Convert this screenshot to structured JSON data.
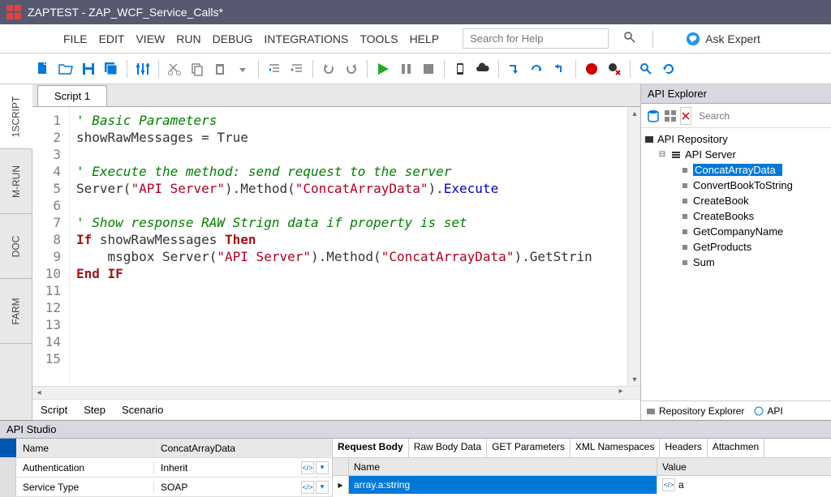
{
  "titlebar": {
    "app": "ZAPTEST",
    "doc": "ZAP_WCF_Service_Calls*"
  },
  "menu": [
    "FILE",
    "EDIT",
    "VIEW",
    "RUN",
    "DEBUG",
    "INTEGRATIONS",
    "TOOLS",
    "HELP"
  ],
  "search_placeholder": "Search for Help",
  "ask_expert": "Ask Expert",
  "left_tabs": [
    "1SCRIPT",
    "M-RUN",
    "DOC",
    "FARM"
  ],
  "script_tab": "Script 1",
  "code": {
    "lines": [
      {
        "n": 1,
        "t": "comment",
        "text": "' Basic Parameters"
      },
      {
        "n": 2,
        "t": "assign",
        "text": "showRawMessages = True"
      },
      {
        "n": 3,
        "t": "blank",
        "text": ""
      },
      {
        "n": 4,
        "t": "comment",
        "text": "' Execute the method: send request to the server"
      },
      {
        "n": 5,
        "t": "call",
        "pre": "Server(",
        "s1": "\"API Server\"",
        "mid1": ").Method(",
        "s2": "\"ConcatArrayData\"",
        "mid2": ").",
        "exec": "Execute"
      },
      {
        "n": 6,
        "t": "blank",
        "text": ""
      },
      {
        "n": 7,
        "t": "comment",
        "text": "' Show response RAW Strign data if property is set"
      },
      {
        "n": 8,
        "t": "ifline",
        "kw": "If",
        "rest": " showRawMessages ",
        "kw2": "Then"
      },
      {
        "n": 9,
        "t": "msgbox",
        "pre": "    msgbox Server(",
        "s1": "\"API Server\"",
        "mid1": ").Method(",
        "s2": "\"ConcatArrayData\"",
        "mid2": ").GetStrin"
      },
      {
        "n": 10,
        "t": "end",
        "text": "End IF"
      },
      {
        "n": 11,
        "t": "blank",
        "text": ""
      },
      {
        "n": 12,
        "t": "blank",
        "text": ""
      },
      {
        "n": 13,
        "t": "blank",
        "text": ""
      },
      {
        "n": 14,
        "t": "blank",
        "text": ""
      },
      {
        "n": 15,
        "t": "blank",
        "text": ""
      }
    ]
  },
  "bottom_tabs": [
    "Script",
    "Step",
    "Scenario"
  ],
  "api_explorer": {
    "title": "API Explorer",
    "search_placeholder": "Search",
    "root": "API Repository",
    "server": "API Server",
    "methods": [
      "ConcatArrayData",
      "ConvertBookToString",
      "CreateBook",
      "CreateBooks",
      "GetCompanyName",
      "GetProducts",
      "Sum"
    ],
    "selected_index": 0,
    "bottom_tabs": [
      "Repository Explorer",
      "API"
    ]
  },
  "api_studio": {
    "title": "API Studio",
    "headers": {
      "name": "Name",
      "value": "ConcatArrayData"
    },
    "rows": [
      {
        "name": "Authentication",
        "value": "Inherit"
      },
      {
        "name": "Service Type",
        "value": "SOAP"
      }
    ],
    "request_tabs": [
      "Request Body",
      "Raw Body Data",
      "GET Parameters",
      "XML Namespaces",
      "Headers",
      "Attachmen"
    ],
    "grid_headers": {
      "name": "Name",
      "value": "Value"
    },
    "grid_row": {
      "name": "array.a:string",
      "value": "a"
    }
  }
}
